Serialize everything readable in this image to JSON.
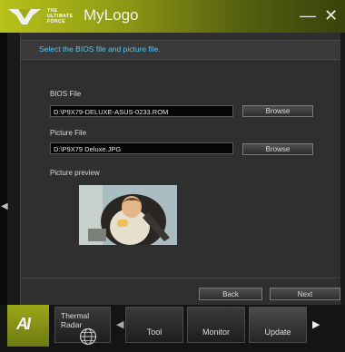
{
  "window": {
    "brand_lines": [
      "THE",
      "ULTIMATE",
      "FORCE"
    ],
    "title": "MyLogo",
    "minimize_label": "—",
    "close_label": "✕"
  },
  "panel": {
    "instruction": "Select the BIOS file and picture file.",
    "bios_label": "BIOS File",
    "bios_value": "D:\\P9X79-DELUXE-ASUS-0233.ROM",
    "picture_label": "Picture File",
    "picture_value": "D:\\P9X79 Deluxe.JPG",
    "browse_label": "Browse",
    "preview_label": "Picture preview",
    "back_label": "Back",
    "next_label": "Next"
  },
  "dock": {
    "ai_label": "AI",
    "thermal_line1": "Thermal",
    "thermal_line2": "Radar",
    "tool_label": "Tool",
    "monitor_label": "Monitor",
    "update_label": "Update"
  },
  "colors": {
    "accent": "#b8c21a",
    "instruction_text": "#5fc4ea"
  }
}
